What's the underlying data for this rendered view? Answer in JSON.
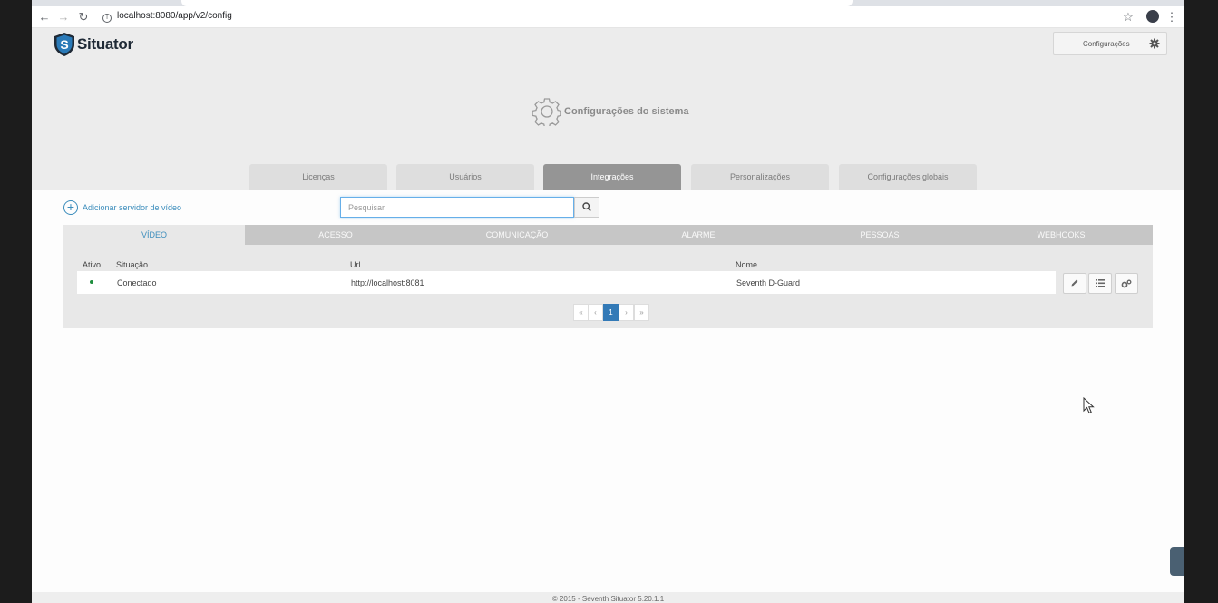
{
  "browser": {
    "url": "localhost:8080/app/v2/config"
  },
  "app": {
    "logo_text": "Situator",
    "logo_letter": "S",
    "config_button_label": "Configurações",
    "page_title": "Configurações do sistema"
  },
  "main_tabs": [
    {
      "label": "Licenças"
    },
    {
      "label": "Usuários"
    },
    {
      "label": "Integrações"
    },
    {
      "label": "Personalizações"
    },
    {
      "label": "Configurações globais"
    }
  ],
  "content": {
    "add_server_label": "Adicionar servidor de vídeo",
    "search_placeholder": "Pesquisar"
  },
  "sub_tabs": [
    {
      "label": "VÍDEO"
    },
    {
      "label": "ACESSO"
    },
    {
      "label": "COMUNICAÇÃO"
    },
    {
      "label": "ALARME"
    },
    {
      "label": "PESSOAS"
    },
    {
      "label": "WEBHOOKS"
    }
  ],
  "table": {
    "headers": {
      "active": "Ativo",
      "status": "Situação",
      "url": "Url",
      "name": "Nome"
    },
    "rows": [
      {
        "status": "Conectado",
        "url": "http://localhost:8081",
        "name": "Seventh D-Guard"
      }
    ]
  },
  "pagination": {
    "first": "«",
    "prev": "‹",
    "current": "1",
    "next": "›",
    "last": "»"
  },
  "footer": {
    "text": "© 2015 - Seventh Situator 5.20.1.1"
  },
  "colors": {
    "accent": "#3c8dbc",
    "active_tab": "#959595",
    "pager_active": "#337ab7",
    "status_ok": "#1e8e3e"
  }
}
